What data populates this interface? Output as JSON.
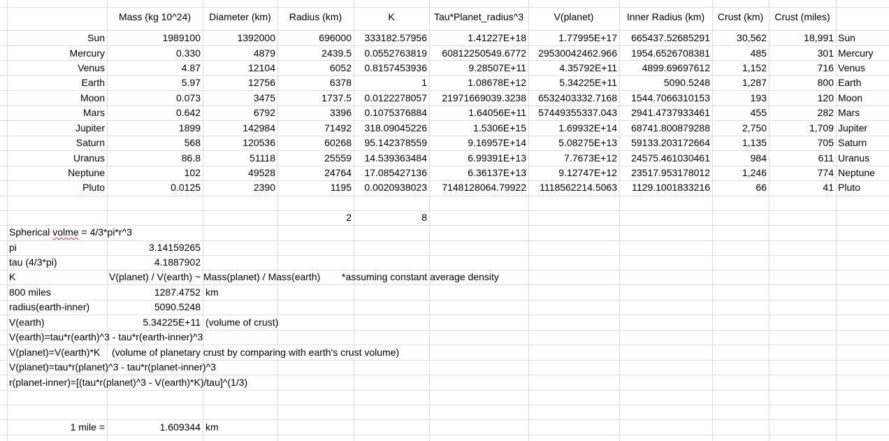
{
  "headers": [
    "Mass (kg 10^24)",
    "Diameter (km)",
    "Radius (km)",
    "K",
    "Tau*Planet_radius^3",
    "V(planet)",
    "Inner Radius (km)",
    "Crust (km)",
    "Crust (miles)"
  ],
  "rows": [
    {
      "name": "Sun",
      "mass": "1989100",
      "diameter": "1392000",
      "radius": "696000",
      "k": "333182.57956",
      "tau_r3": "1.41227E+18",
      "v_planet": "1.77995E+17",
      "inner": "665437.52685291",
      "crust_km": "30,562",
      "crust_mi": "18,991",
      "label": "Sun"
    },
    {
      "name": "Mercury",
      "mass": "0.330",
      "diameter": "4879",
      "radius": "2439.5",
      "k": "0.0552763819",
      "tau_r3": "60812250549.6772",
      "v_planet": "29530042462.966",
      "inner": "1954.6526708381",
      "crust_km": "485",
      "crust_mi": "301",
      "label": "Mercury"
    },
    {
      "name": "Venus",
      "mass": "4.87",
      "diameter": "12104",
      "radius": "6052",
      "k": "0.8157453936",
      "tau_r3": "9.28507E+11",
      "v_planet": "4.35792E+11",
      "inner": "4899.69697612",
      "crust_km": "1,152",
      "crust_mi": "716",
      "label": "Venus"
    },
    {
      "name": "Earth",
      "mass": "5.97",
      "diameter": "12756",
      "radius": "6378",
      "k": "1",
      "tau_r3": "1.08678E+12",
      "v_planet": "5.34225E+11",
      "inner": "5090.5248",
      "crust_km": "1,287",
      "crust_mi": "800",
      "label": "Earth"
    },
    {
      "name": "Moon",
      "mass": "0.073",
      "diameter": "3475",
      "radius": "1737.5",
      "k": "0.0122278057",
      "tau_r3": "21971669039.3238",
      "v_planet": "6532403332.7168",
      "inner": "1544.7066310153",
      "crust_km": "193",
      "crust_mi": "120",
      "label": "Moon"
    },
    {
      "name": "Mars",
      "mass": "0.642",
      "diameter": "6792",
      "radius": "3396",
      "k": "0.1075376884",
      "tau_r3": "1.64056E+11",
      "v_planet": "57449355337.043",
      "inner": "2941.4737933461",
      "crust_km": "455",
      "crust_mi": "282",
      "label": "Mars"
    },
    {
      "name": "Jupiter",
      "mass": "1899",
      "diameter": "142984",
      "radius": "71492",
      "k": "318.09045226",
      "tau_r3": "1.5306E+15",
      "v_planet": "1.69932E+14",
      "inner": "68741.800879288",
      "crust_km": "2,750",
      "crust_mi": "1,709",
      "label": "Jupiter"
    },
    {
      "name": "Saturn",
      "mass": "568",
      "diameter": "120536",
      "radius": "60268",
      "k": "95.142378559",
      "tau_r3": "9.16957E+14",
      "v_planet": "5.08275E+13",
      "inner": "59133.203172664",
      "crust_km": "1,135",
      "crust_mi": "705",
      "label": "Saturn"
    },
    {
      "name": "Uranus",
      "mass": "86.8",
      "diameter": "51118",
      "radius": "25559",
      "k": "14.539363484",
      "tau_r3": "6.99391E+13",
      "v_planet": "7.7673E+12",
      "inner": "24575.461030461",
      "crust_km": "984",
      "crust_mi": "611",
      "label": "Uranus"
    },
    {
      "name": "Neptune",
      "mass": "102",
      "diameter": "49528",
      "radius": "24764",
      "k": "17.085427136",
      "tau_r3": "6.36137E+13",
      "v_planet": "9.12747E+12",
      "inner": "23517.953178012",
      "crust_km": "1,246",
      "crust_mi": "774",
      "label": "Neptune"
    },
    {
      "name": "Pluto",
      "mass": "0.0125",
      "diameter": "2390",
      "radius": "1195",
      "k": "0.0020938023",
      "tau_r3": "7148128064.79922",
      "v_planet": "1118562214.5063",
      "inner": "1129.1001833216",
      "crust_km": "66",
      "crust_mi": "41",
      "label": "Pluto"
    }
  ],
  "misc": {
    "radius_param": "2",
    "k_param": "8",
    "spherical_prefix": "Spherical ",
    "spherical_word": "volme",
    "spherical_suffix": " = 4/3*pi*r^3",
    "pi_label": "pi",
    "pi_value": "3.14159265",
    "tau_label": "tau (4/3*pi)",
    "tau_value": "4.1887902",
    "k_label": "K",
    "k_formula": "V(planet) / V(earth) ~ Mass(planet) / Mass(earth)",
    "k_note": "*assuming constant average density",
    "miles_label": "800 miles",
    "miles_value": "1287.4752",
    "miles_unit": "km",
    "radius_inner_label": "radius(earth-inner)",
    "radius_inner_value": "5090.5248",
    "vearth_label": "V(earth)",
    "vearth_value": "5.34225E+11",
    "vearth_note": "(volume of crust)",
    "formula1": "V(earth)=tau*r(earth)^3 - tau*r(earth-inner)^3",
    "formula2_a": "V(planet)=V(earth)*K",
    "formula2_b": "(volume of planetary crust by comparing with earth's crust volume)",
    "formula3": "V(planet)=tau*r(planet)^3 - tau*r(planet-inner)^3",
    "formula4": "r(planet-inner)=[(tau*r(planet)^3 - V(earth)*K)/tau]^(1/3)",
    "mile_label": "1 mile =",
    "mile_value": "1.609344",
    "mile_unit": "km"
  }
}
